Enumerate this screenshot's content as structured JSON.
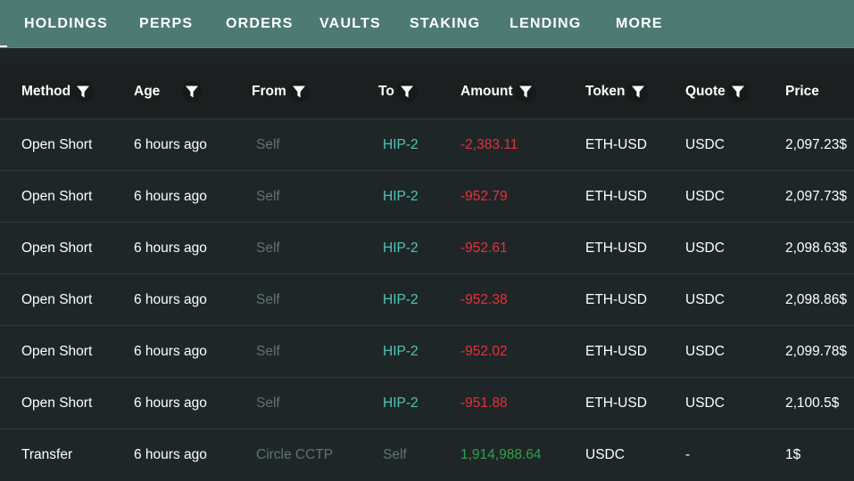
{
  "tabs": [
    {
      "label": "HOLDINGS"
    },
    {
      "label": "PERPS"
    },
    {
      "label": "ORDERS"
    },
    {
      "label": "VAULTS"
    },
    {
      "label": "STAKING"
    },
    {
      "label": "LENDING"
    },
    {
      "label": "MORE"
    }
  ],
  "table": {
    "headers": {
      "method": "Method",
      "age": "Age",
      "from": "From",
      "to": "To",
      "amount": "Amount",
      "token": "Token",
      "quote": "Quote",
      "price": "Price"
    },
    "rows": [
      {
        "method": "Open Short",
        "age": "6 hours ago",
        "from": "Self",
        "to": "HIP-2",
        "amount": "-2,383.11",
        "token": "ETH-USD",
        "quote": "USDC",
        "price": "2,097.23$"
      },
      {
        "method": "Open Short",
        "age": "6 hours ago",
        "from": "Self",
        "to": "HIP-2",
        "amount": "-952.79",
        "token": "ETH-USD",
        "quote": "USDC",
        "price": "2,097.73$"
      },
      {
        "method": "Open Short",
        "age": "6 hours ago",
        "from": "Self",
        "to": "HIP-2",
        "amount": "-952.61",
        "token": "ETH-USD",
        "quote": "USDC",
        "price": "2,098.63$"
      },
      {
        "method": "Open Short",
        "age": "6 hours ago",
        "from": "Self",
        "to": "HIP-2",
        "amount": "-952.38",
        "token": "ETH-USD",
        "quote": "USDC",
        "price": "2,098.86$"
      },
      {
        "method": "Open Short",
        "age": "6 hours ago",
        "from": "Self",
        "to": "HIP-2",
        "amount": "-952.02",
        "token": "ETH-USD",
        "quote": "USDC",
        "price": "2,099.78$"
      },
      {
        "method": "Open Short",
        "age": "6 hours ago",
        "from": "Self",
        "to": "HIP-2",
        "amount": "-951.88",
        "token": "ETH-USD",
        "quote": "USDC",
        "price": "2,100.5$"
      },
      {
        "method": "Transfer",
        "age": "6 hours ago",
        "from": "Circle CCTP",
        "to": "Self",
        "amount": "1,914,988.64",
        "token": "USDC",
        "quote": "-",
        "price": "1$"
      }
    ]
  },
  "colors": {
    "tabbar": "#4e7a74",
    "header_bg": "#1b1f20",
    "row_bg": "#1f2628",
    "link": "#4fc5b2",
    "negative": "#e5323b",
    "positive": "#2fa14a",
    "muted": "#5f7371"
  },
  "icons": {
    "filter": "filter-icon"
  }
}
